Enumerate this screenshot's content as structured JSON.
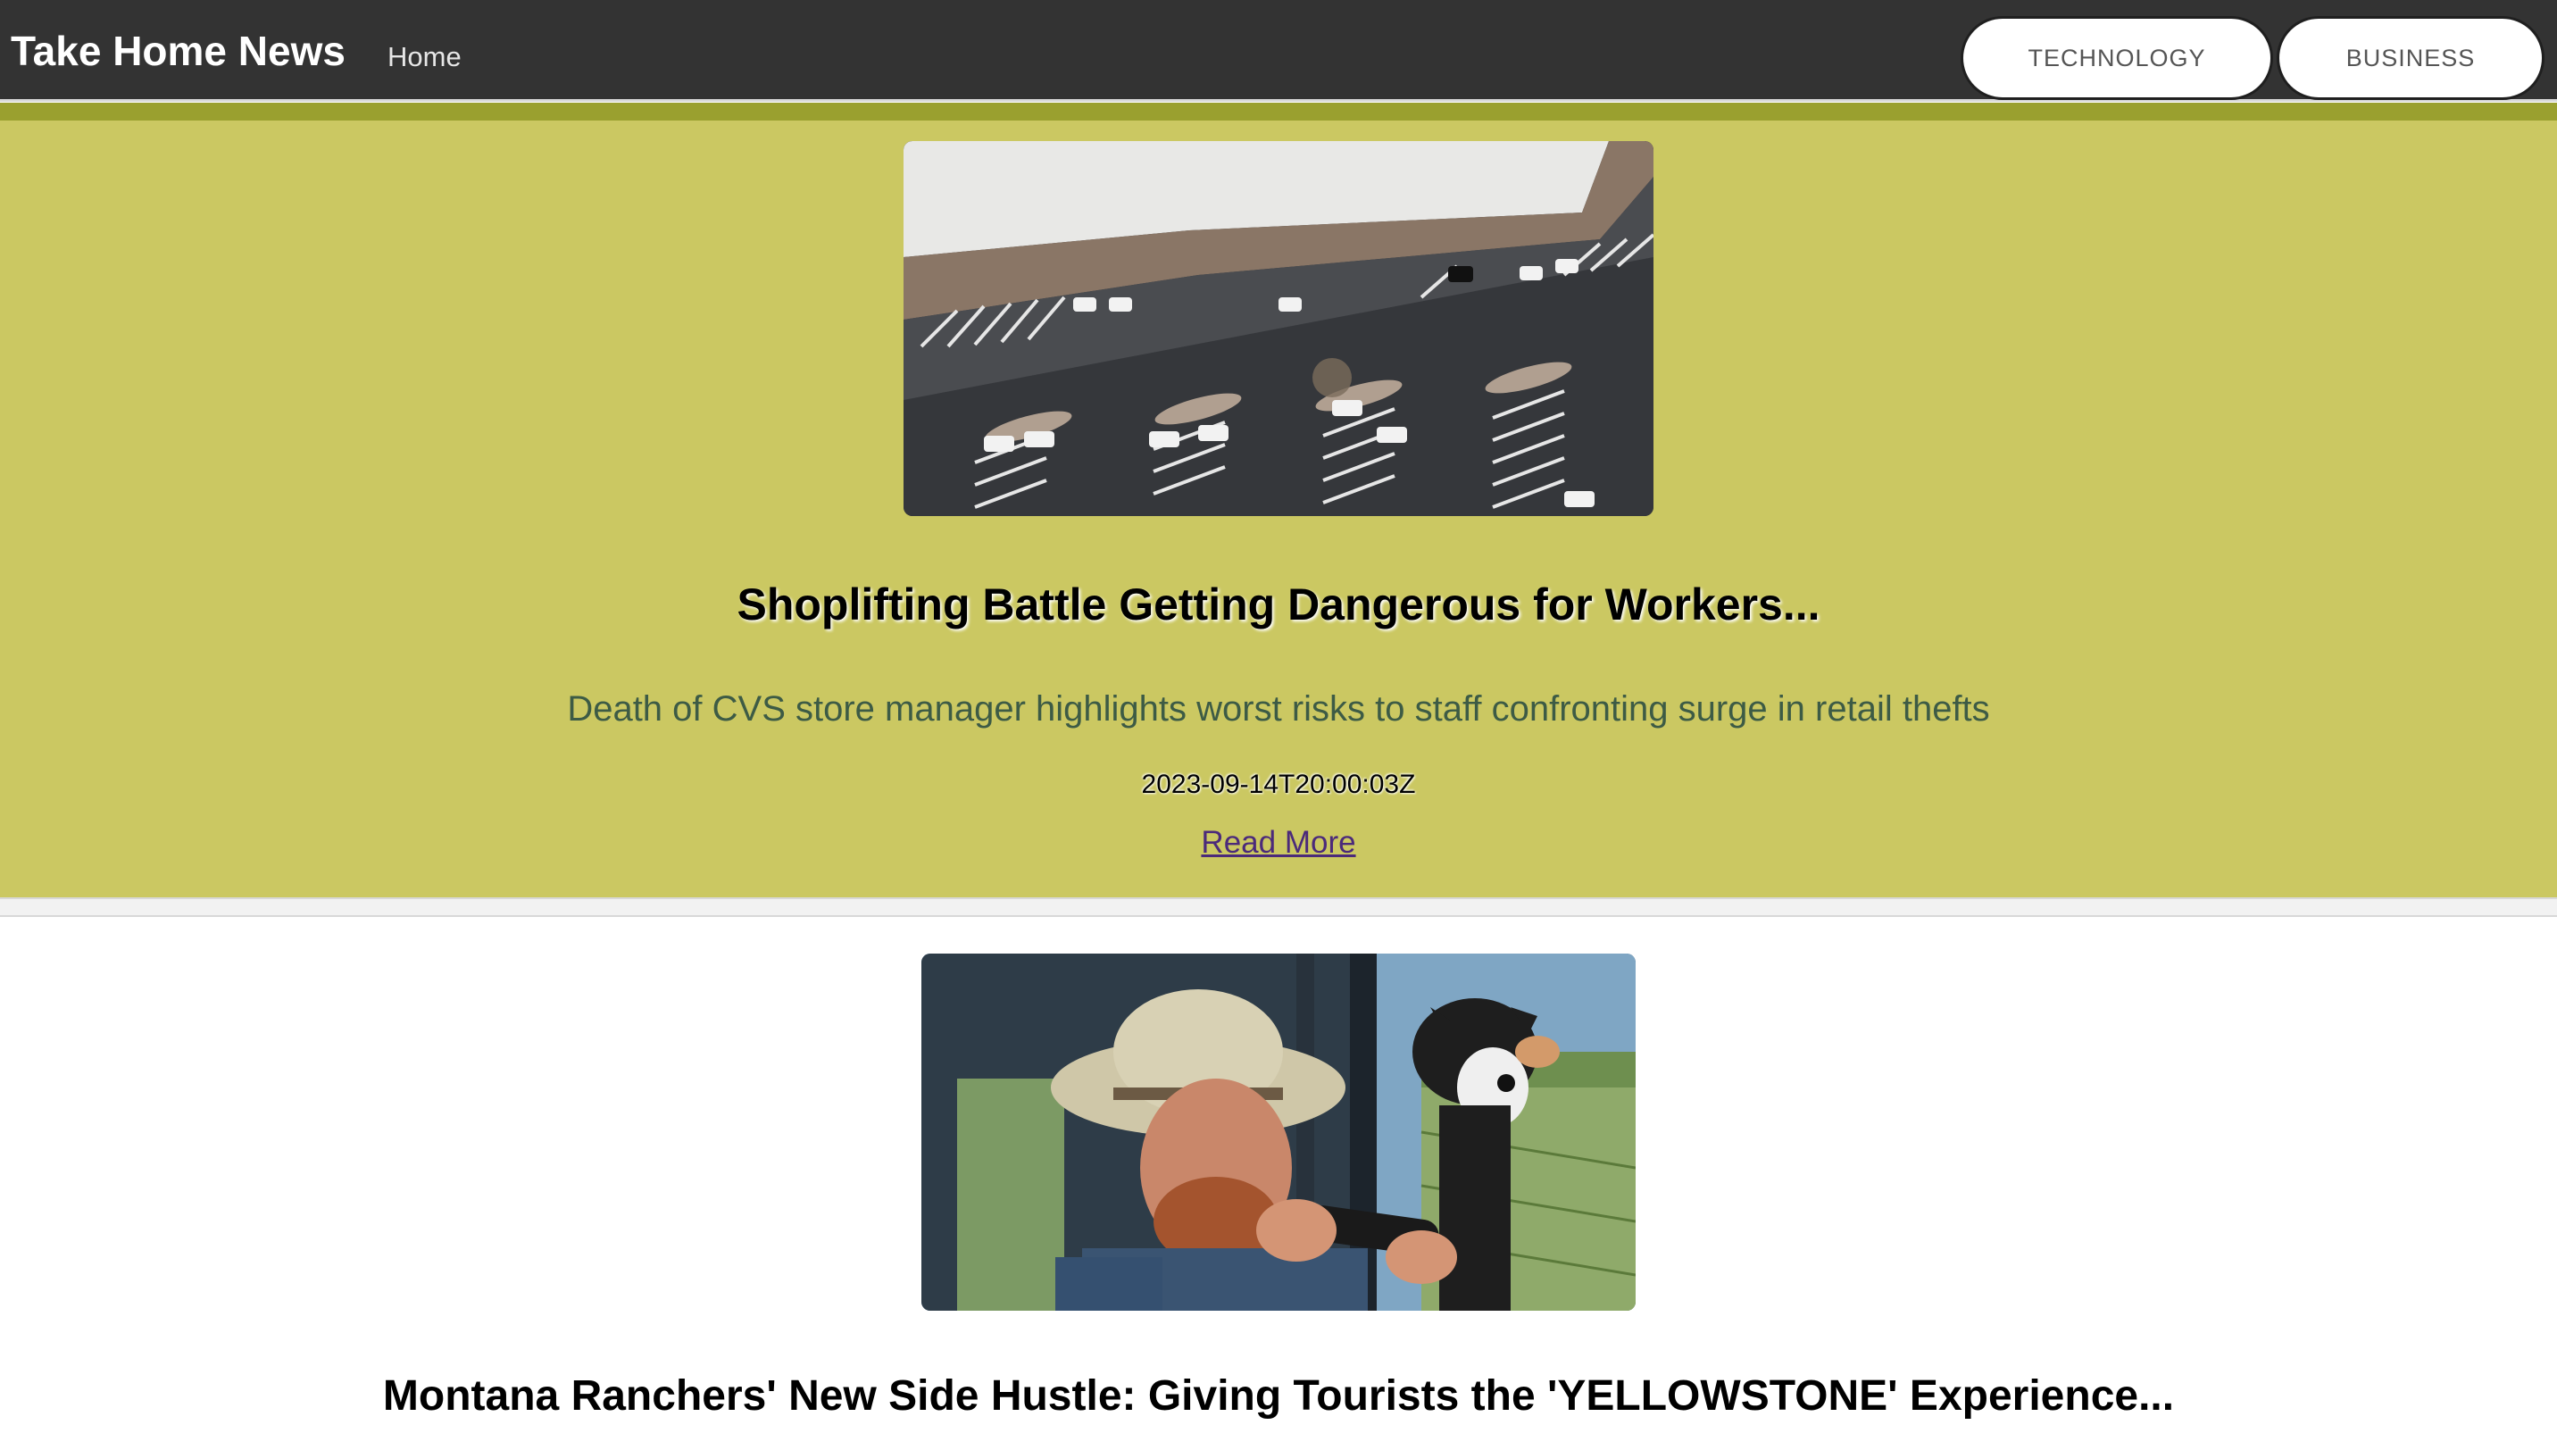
{
  "header": {
    "brand": "Take Home News",
    "home_link": "Home",
    "categories": [
      {
        "label": "TECHNOLOGY"
      },
      {
        "label": "BUSINESS"
      }
    ]
  },
  "articles": [
    {
      "title": "Shoplifting Battle Getting Dangerous for Workers...",
      "description": "Death of CVS store manager highlights worst risks to staff confronting surge in retail thefts",
      "published_at": "2023-09-14T20:00:03Z",
      "read_more": "Read More",
      "image_subject": "aerial view of store parking lot"
    },
    {
      "title": "Montana Ranchers' New Side Hustle: Giving Tourists the 'YELLOWSTONE' Experience...",
      "image_subject": "rancher in hat with dog in vehicle"
    }
  ],
  "colors": {
    "navbar_bg": "#333333",
    "featured_card_bg": "#cbc862",
    "accent_strip": "#9aa02f",
    "description_text": "#3d5b45",
    "link": "#4b2a7a"
  }
}
